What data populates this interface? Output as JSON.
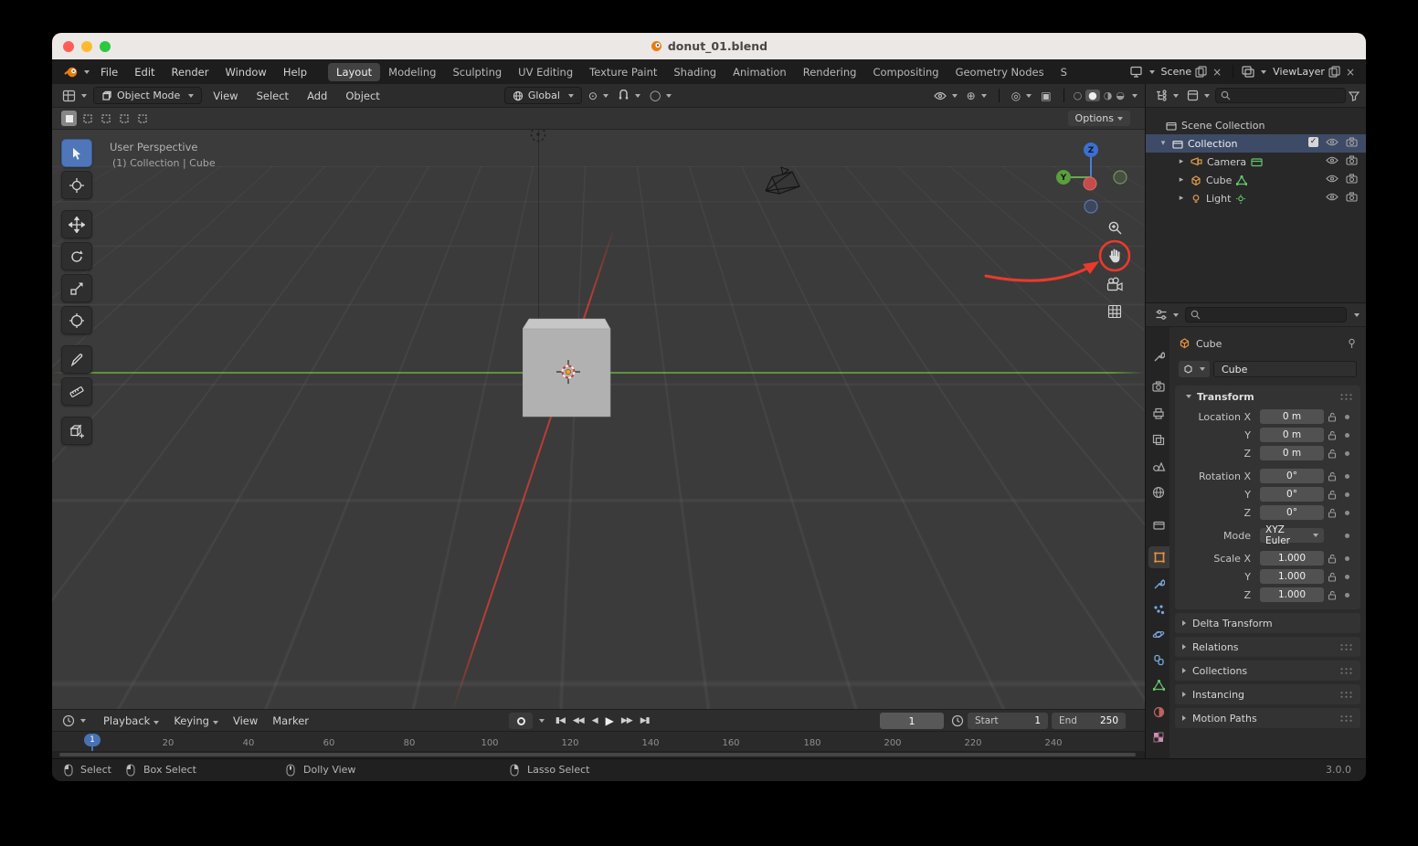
{
  "window": {
    "title": "donut_01.blend"
  },
  "menubar": {
    "menus": [
      "File",
      "Edit",
      "Render",
      "Window",
      "Help"
    ],
    "workspaces": [
      "Layout",
      "Modeling",
      "Sculpting",
      "UV Editing",
      "Texture Paint",
      "Shading",
      "Animation",
      "Rendering",
      "Compositing",
      "Geometry Nodes",
      "S"
    ],
    "scene_label": "Scene",
    "view_layer_label": "ViewLayer"
  },
  "viewport_header": {
    "mode": "Object Mode",
    "menus": [
      "View",
      "Select",
      "Add",
      "Object"
    ],
    "orientation": "Global",
    "options_label": "Options"
  },
  "viewport": {
    "perspective_label": "User Perspective",
    "context_label": "(1) Collection | Cube",
    "gizmo": {
      "z": "Z",
      "y": "Y"
    }
  },
  "outliner": {
    "scene_collection": "Scene Collection",
    "collection": "Collection",
    "objects": [
      "Camera",
      "Cube",
      "Light"
    ]
  },
  "properties": {
    "breadcrumb": "Cube",
    "object_name": "Cube",
    "transform_title": "Transform",
    "rows": [
      {
        "label": "Location X",
        "value": "0 m"
      },
      {
        "label": "Y",
        "value": "0 m"
      },
      {
        "label": "Z",
        "value": "0 m"
      },
      {
        "label": "Rotation X",
        "value": "0°"
      },
      {
        "label": "Y",
        "value": "0°"
      },
      {
        "label": "Z",
        "value": "0°"
      },
      {
        "label": "Mode",
        "value": "XYZ Euler"
      },
      {
        "label": "Scale X",
        "value": "1.000"
      },
      {
        "label": "Y",
        "value": "1.000"
      },
      {
        "label": "Z",
        "value": "1.000"
      }
    ],
    "panels": [
      "Delta Transform",
      "Relations",
      "Collections",
      "Instancing",
      "Motion Paths"
    ]
  },
  "timeline": {
    "menus": [
      "Playback",
      "Keying",
      "View",
      "Marker"
    ],
    "controls": [
      "▮◀",
      "◀◀",
      "◀",
      "▶",
      "▶▶",
      "▶▮"
    ],
    "current_frame": "1",
    "start_label": "Start",
    "start_value": "1",
    "end_label": "End",
    "end_value": "250",
    "ticks": [
      "20",
      "40",
      "60",
      "80",
      "100",
      "120",
      "140",
      "160",
      "180",
      "200",
      "220",
      "240"
    ],
    "marker_frame": "1"
  },
  "statusbar": {
    "items": [
      "Select",
      "Box Select",
      "Dolly View",
      "Lasso Select"
    ],
    "version": "3.0.0"
  }
}
